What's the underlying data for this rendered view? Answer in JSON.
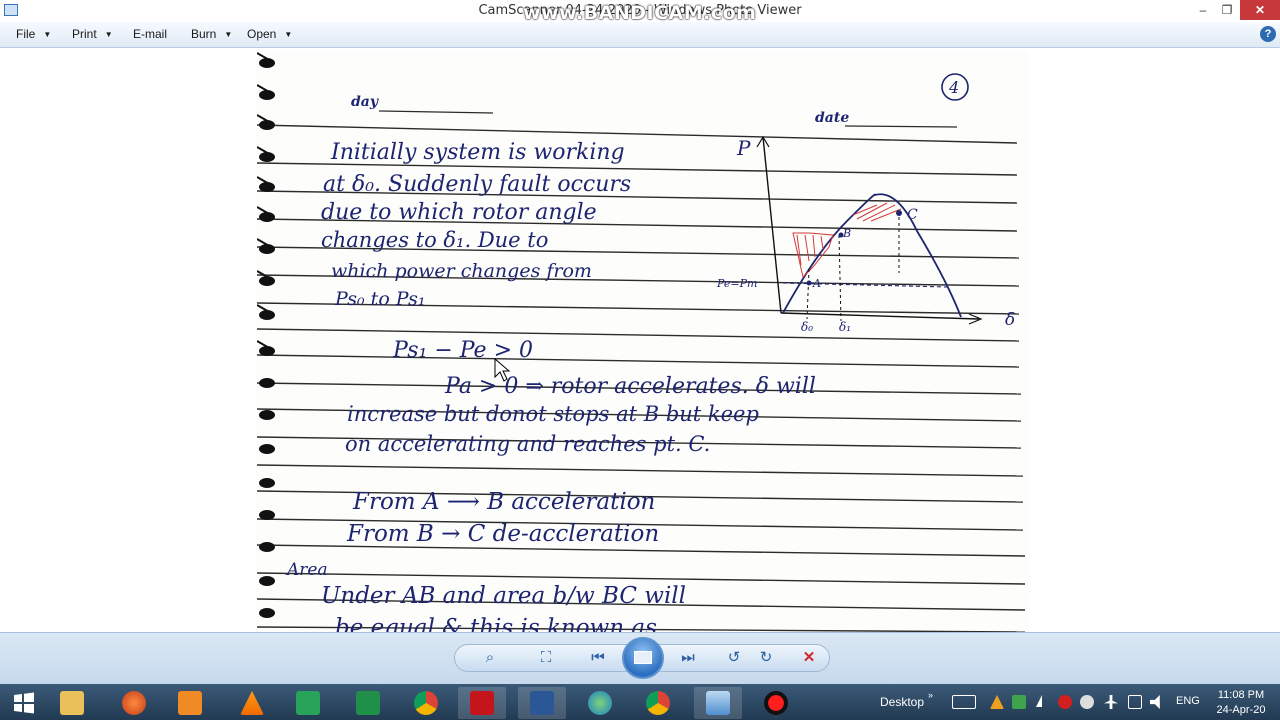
{
  "window": {
    "title": "CamScanner 04-24-2020 - Windows Photo Viewer",
    "watermark": "www.BANDICAM.com",
    "controls": {
      "minimize": "–",
      "maximize": "❐",
      "close": "✕"
    }
  },
  "menu": {
    "file": "File",
    "print": "Print",
    "email": "E-mail",
    "burn": "Burn",
    "open": "Open",
    "help": "?"
  },
  "notes": {
    "header_day": "day",
    "header_date": "date",
    "page_number": "4",
    "para1": [
      "Initially system is working",
      "at δ₀. Suddenly fault occurs",
      "due to which rotor angle",
      "changes to δ₁. Due to",
      "which power changes from",
      "Ps₀ to Ps₁"
    ],
    "graph": {
      "y_axis": "P",
      "x_axis": "δ",
      "pe_label": "Pe=Pm",
      "point_a": "A",
      "point_b": "B",
      "point_c": "C",
      "tick_d0": "δ₀",
      "tick_d1": "δ₁"
    },
    "eq1": "Ps₁ − Pe > 0",
    "eq2": "Pa > 0   ⇒ rotor accelerates. δ will",
    "line3": "increase but donot stops at B but keep",
    "line4": "on accelerating and reaches pt. C.",
    "line5": "From A ⟶ B     acceleration",
    "line6": "From B → C    de-accleration",
    "area_label": "Area",
    "line7": "Under AB and area b/w BC will",
    "line8": "be equal & this is known as"
  },
  "controlbar": {
    "zoom": "⌕",
    "fit": "⛶",
    "prev": "⏮",
    "next": "⏭",
    "rotate_ccw": "↺",
    "rotate_cw": "↻",
    "delete": "✕"
  },
  "taskbar": {
    "desktop_label": "Desktop",
    "language": "ENG",
    "time": "11:08 PM",
    "date": "24-Apr-20",
    "apps": [
      "windows-start",
      "file-explorer",
      "ccleaner",
      "media-player",
      "vlc",
      "camscanner-app",
      "excel",
      "chrome",
      "acrobat",
      "word",
      "globe-app",
      "chrome-2",
      "photo-viewer",
      "bandicam-record"
    ]
  },
  "colors": {
    "ink": "#1d2470",
    "line": "#2b2b2b",
    "hatch": "#d23a3a",
    "taskbar": "#2a4460",
    "menubar": "#dfeaf6"
  }
}
